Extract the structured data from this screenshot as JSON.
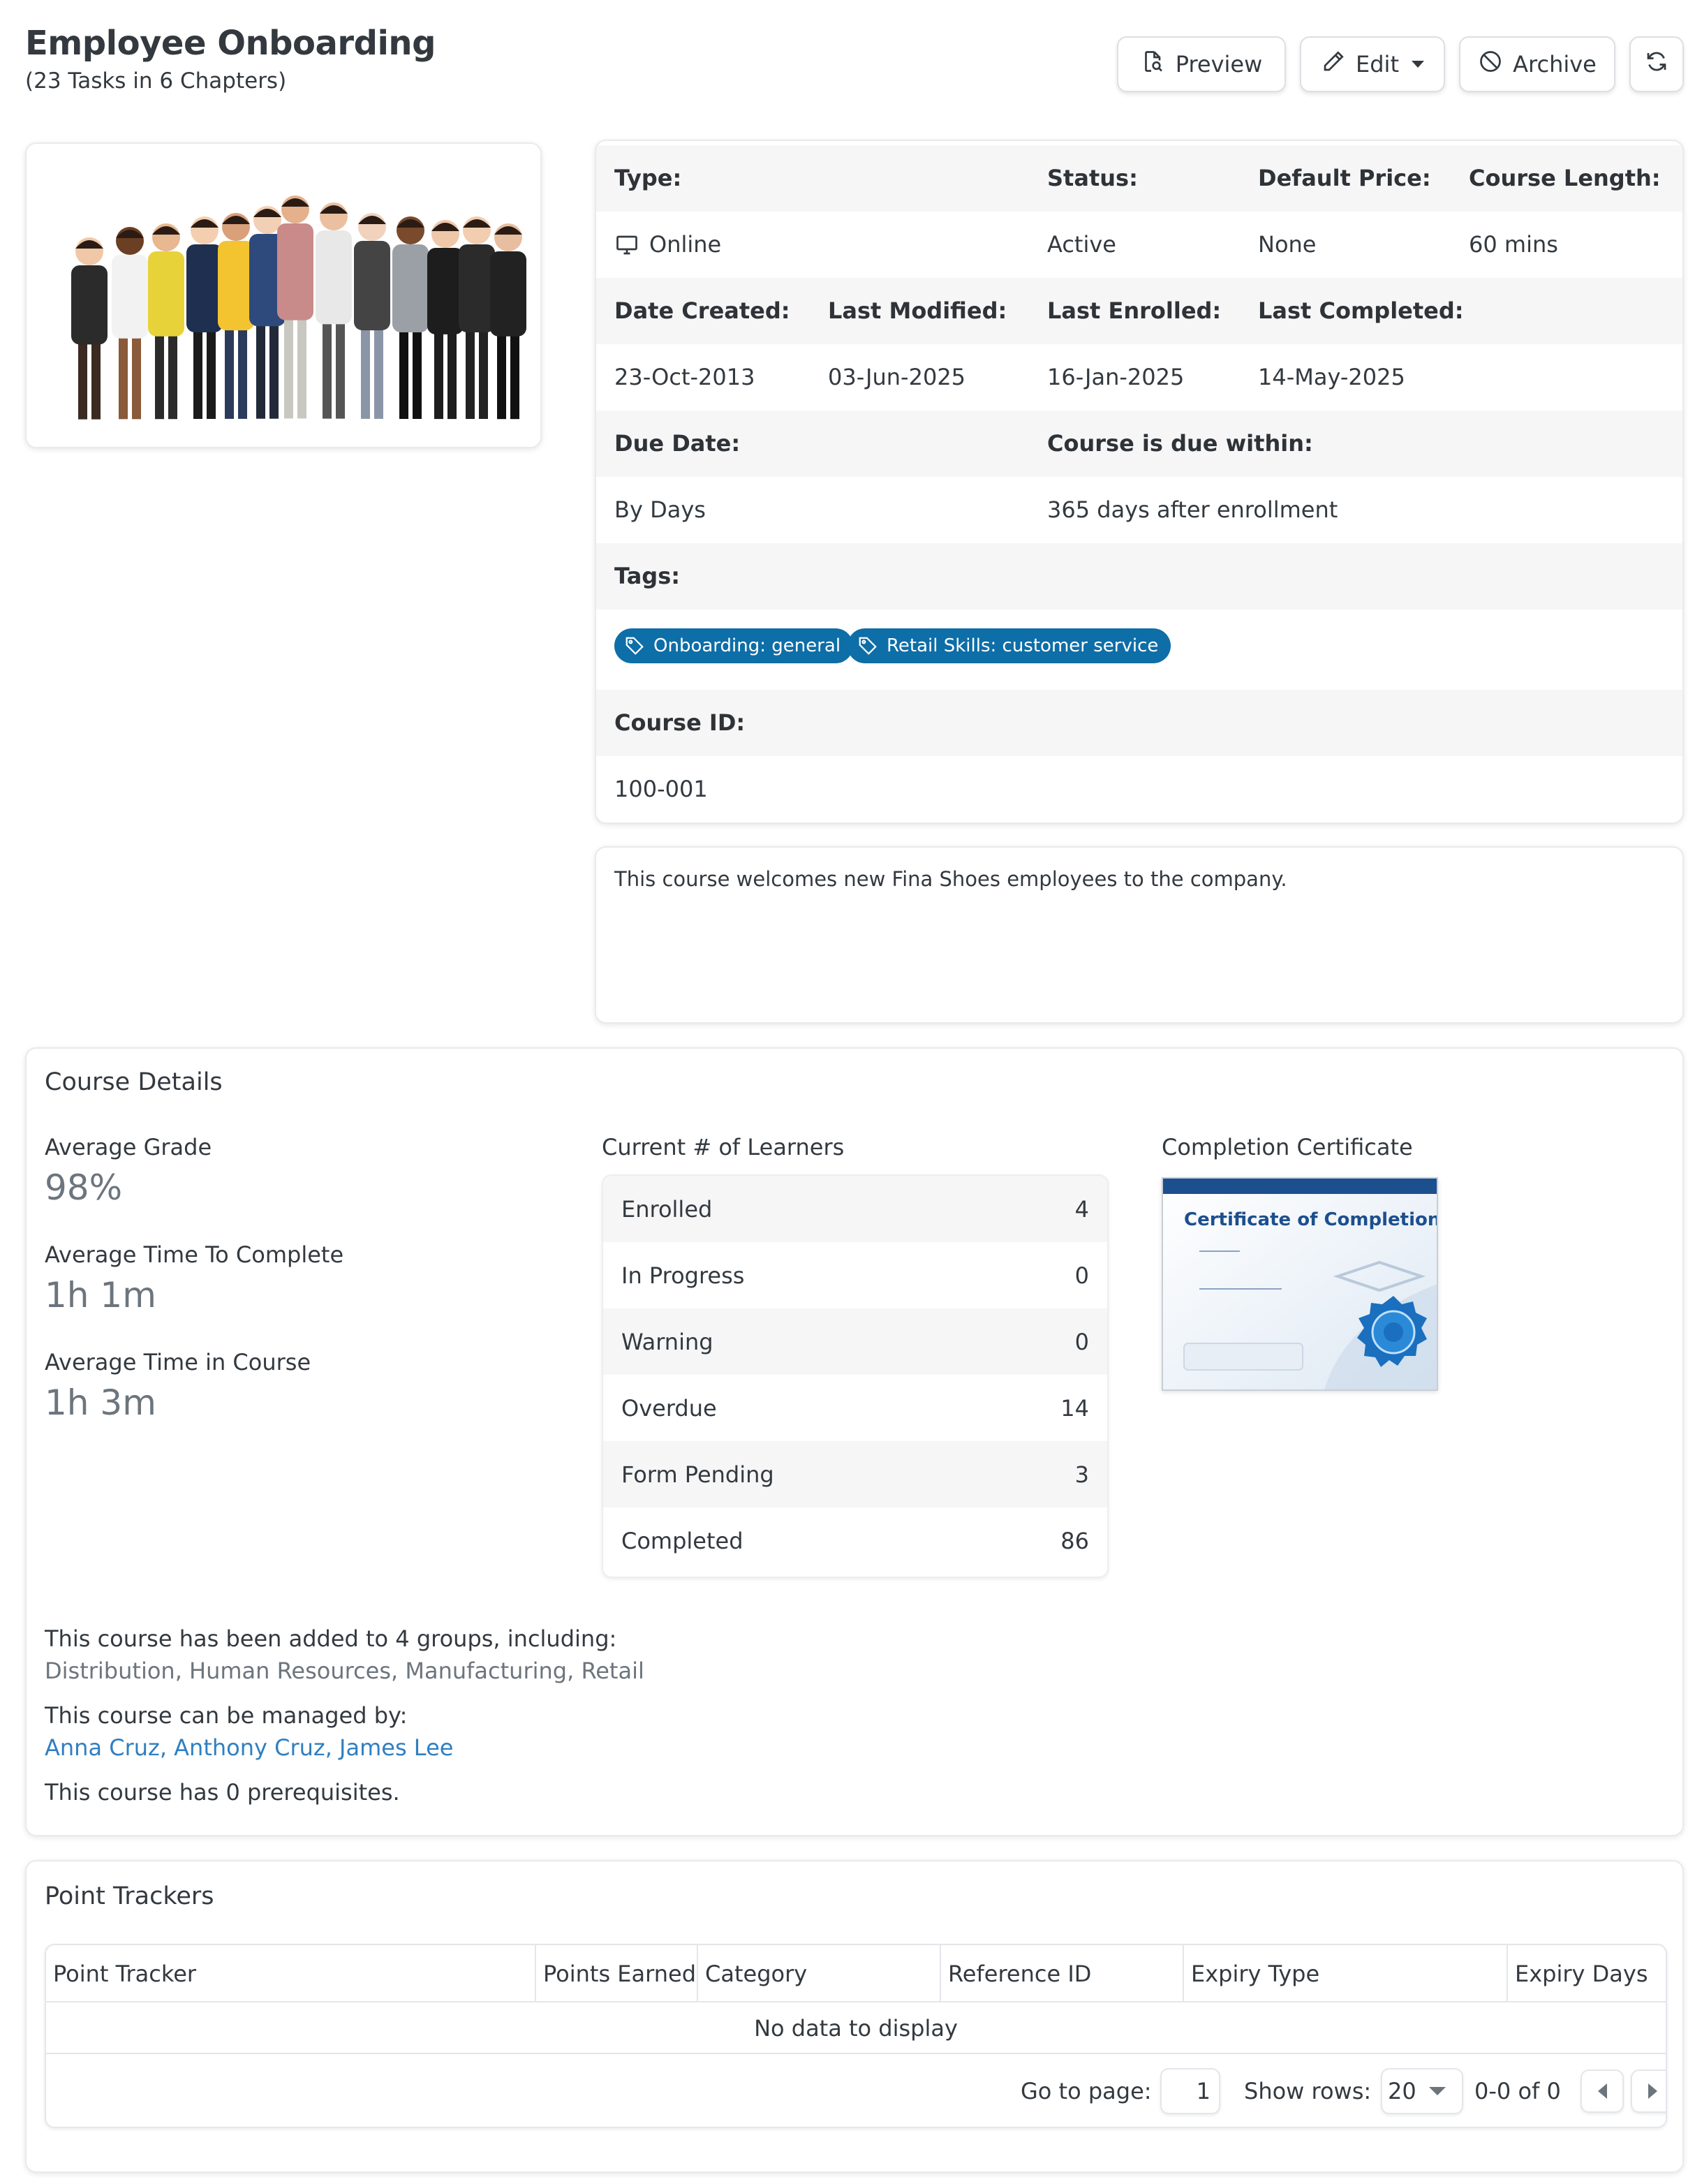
{
  "header": {
    "title": "Employee Onboarding",
    "subtitle": "(23 Tasks in 6 Chapters)",
    "preview_label": "Preview",
    "edit_label": "Edit",
    "archive_label": "Archive"
  },
  "info": {
    "type_label": "Type:",
    "type_value": "Online",
    "status_label": "Status:",
    "status_value": "Active",
    "price_label": "Default Price:",
    "price_value": "None",
    "length_label": "Course Length:",
    "length_value": "60 mins",
    "created_label": "Date Created:",
    "created_value": "23-Oct-2013",
    "modified_label": "Last Modified:",
    "modified_value": "03-Jun-2025",
    "enrolled_label": "Last Enrolled:",
    "enrolled_value": "16-Jan-2025",
    "completed_label": "Last Completed:",
    "completed_value": "14-May-2025",
    "due_label": "Due Date:",
    "due_value": "By Days",
    "due_within_label": "Course is due within:",
    "due_within_value": "365 days after enrollment",
    "tags_label": "Tags:",
    "tags": [
      "Onboarding: general",
      "Retail Skills: customer service"
    ],
    "course_id_label": "Course ID:",
    "course_id_value": "100-001"
  },
  "description": "This course welcomes new Fina Shoes employees to the company.",
  "details": {
    "title": "Course Details",
    "avg_grade_label": "Average Grade",
    "avg_grade_value": "98%",
    "avg_time_complete_label": "Average Time To Complete",
    "avg_time_complete_value": "1h 1m",
    "avg_time_course_label": "Average Time in Course",
    "avg_time_course_value": "1h 3m",
    "learners_title": "Current # of Learners",
    "learners": [
      {
        "label": "Enrolled",
        "value": "4"
      },
      {
        "label": "In Progress",
        "value": "0"
      },
      {
        "label": "Warning",
        "value": "0"
      },
      {
        "label": "Overdue",
        "value": "14"
      },
      {
        "label": "Form Pending",
        "value": "3"
      },
      {
        "label": "Completed",
        "value": "86"
      }
    ],
    "certificate_title": "Completion Certificate",
    "certificate_heading": "Certificate of Completion",
    "groups_text": "This course has been added to 4 groups, including:",
    "groups_list": "Distribution, Human Resources, Manufacturing, Retail",
    "managed_text": "This course can be managed by:",
    "managers": "Anna Cruz, Anthony Cruz, James Lee",
    "prereq_text": "This course has 0 prerequisites."
  },
  "point_trackers": {
    "title": "Point Trackers",
    "columns": [
      "Point Tracker",
      "Points Earned",
      "Category",
      "Reference ID",
      "Expiry Type",
      "Expiry Days"
    ],
    "empty_text": "No data to display",
    "go_to_page_label": "Go to page:",
    "page_value": "1",
    "show_rows_label": "Show rows:",
    "rows_value": "20",
    "range_text": "0-0 of 0"
  },
  "colors": {
    "tag_bg": "#0d6ea8",
    "link": "#2f7fc1",
    "muted": "#6c757d"
  }
}
